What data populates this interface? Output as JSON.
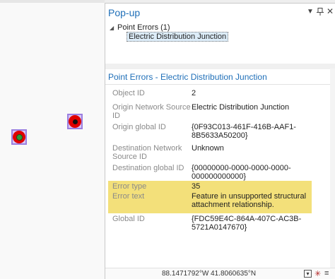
{
  "map": {
    "markers": [
      {
        "name": "map-feature-marker-selected",
        "icon": "junction-red-black"
      },
      {
        "name": "map-feature-marker-green",
        "icon": "junction-red-green"
      }
    ]
  },
  "popup": {
    "title": "Pop-up",
    "tree": {
      "group_label": "Point Errors  (1)",
      "child_label": "Electric Distribution Junction"
    },
    "section_title": "Point Errors - Electric Distribution Junction",
    "fields": [
      {
        "name": "Object ID",
        "value": "2",
        "highlight": false
      },
      {
        "name": "Origin Network Source ID",
        "value": "Electric Distribution Junction",
        "highlight": false
      },
      {
        "name": "Origin global ID",
        "value": "{0F93C013-461F-416B-AAF1-8B5633A50200}",
        "highlight": false
      },
      {
        "name": "Destination Network Source ID",
        "value": "Unknown",
        "highlight": false
      },
      {
        "name": "Destination global ID",
        "value": "{00000000-0000-0000-0000-000000000000}",
        "highlight": false
      },
      {
        "name": "Error type",
        "value": "35",
        "highlight": true
      },
      {
        "name": "Error text",
        "value": "Feature in unsupported structural attachment relationship.",
        "highlight": true
      },
      {
        "name": "Global ID",
        "value": "{FDC59E4C-864A-407C-AC3B-5721A0147670}",
        "highlight": false
      }
    ],
    "status": {
      "coordinates": "88.1471792°W 41.8060635°N"
    }
  },
  "colors": {
    "accent": "#1f6fb8",
    "highlight": "#f3e07a",
    "marker_red": "#e00000",
    "marker_selection": "#9b7fe0"
  }
}
